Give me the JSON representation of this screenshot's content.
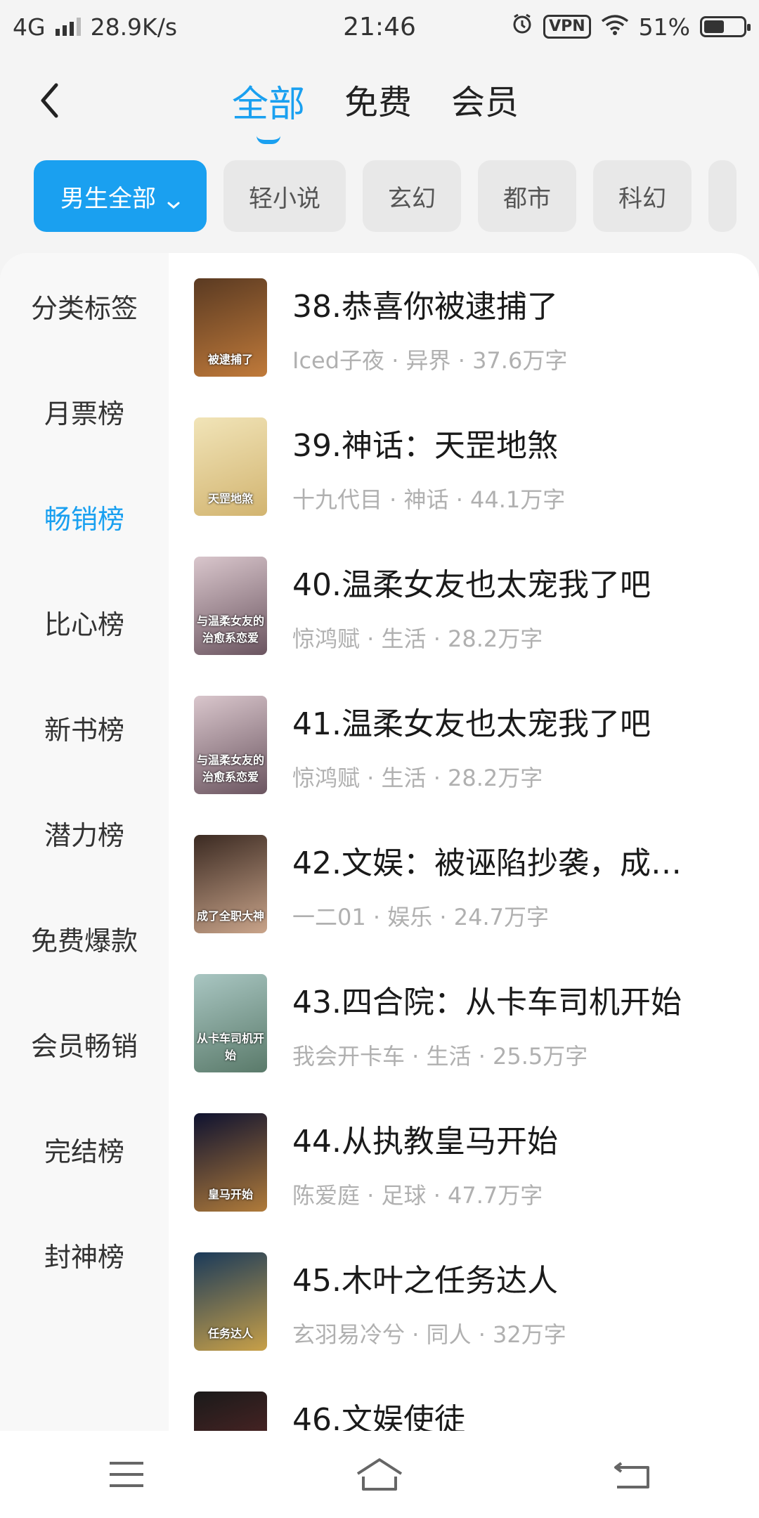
{
  "status": {
    "network": "4G",
    "speed": "28.9K/s",
    "time": "21:46",
    "vpn": "VPN",
    "battery": "51%",
    "battery_level": 0.51
  },
  "tabs": [
    {
      "label": "全部",
      "active": true
    },
    {
      "label": "免费",
      "active": false
    },
    {
      "label": "会员",
      "active": false
    }
  ],
  "filters": [
    {
      "label": "男生全部",
      "active": true
    },
    {
      "label": "轻小说",
      "active": false
    },
    {
      "label": "玄幻",
      "active": false
    },
    {
      "label": "都市",
      "active": false
    },
    {
      "label": "科幻",
      "active": false
    }
  ],
  "sidebar": {
    "items": [
      {
        "label": "分类标签",
        "active": false
      },
      {
        "label": "月票榜",
        "active": false
      },
      {
        "label": "畅销榜",
        "active": true
      },
      {
        "label": "比心榜",
        "active": false
      },
      {
        "label": "新书榜",
        "active": false
      },
      {
        "label": "潜力榜",
        "active": false
      },
      {
        "label": "免费爆款",
        "active": false
      },
      {
        "label": "会员畅销",
        "active": false
      },
      {
        "label": "完结榜",
        "active": false
      },
      {
        "label": "封神榜",
        "active": false
      }
    ]
  },
  "books": [
    {
      "title": "38.恭喜你被逮捕了",
      "meta": "Iced子夜 · 异界 · 37.6万字",
      "cover_text": "被逮捕了",
      "cover_colors": [
        "#5a3a22",
        "#c07a3a"
      ]
    },
    {
      "title": "39.神话：天罡地煞",
      "meta": "十九代目 · 神话 · 44.1万字",
      "cover_text": "天罡地煞",
      "cover_colors": [
        "#f1e4b8",
        "#d2b470"
      ]
    },
    {
      "title": "40.温柔女友也太宠我了吧",
      "meta": "惊鸿赋 · 生活 · 28.2万字",
      "cover_text": "与温柔女友的治愈系恋爱",
      "cover_colors": [
        "#d9c6cc",
        "#6b5560"
      ]
    },
    {
      "title": "41.温柔女友也太宠我了吧",
      "meta": "惊鸿赋 · 生活 · 28.2万字",
      "cover_text": "与温柔女友的治愈系恋爱",
      "cover_colors": [
        "#d9c6cc",
        "#6b5560"
      ]
    },
    {
      "title": "42.文娱：被诬陷抄袭，成…",
      "meta": "一二01 · 娱乐 · 24.7万字",
      "cover_text": "成了全职大神",
      "cover_colors": [
        "#3b2a22",
        "#c9a48a"
      ]
    },
    {
      "title": "43.四合院：从卡车司机开始",
      "meta": "我会开卡车 · 生活 · 25.5万字",
      "cover_text": "从卡车司机开始",
      "cover_colors": [
        "#a9c6c2",
        "#5a7a6a"
      ]
    },
    {
      "title": "44.从执教皇马开始",
      "meta": "陈爱庭 · 足球 · 47.7万字",
      "cover_text": "皇马开始",
      "cover_colors": [
        "#0e1230",
        "#b07b3a"
      ]
    },
    {
      "title": "45.木叶之任务达人",
      "meta": "玄羽易冷兮 · 同人 · 32万字",
      "cover_text": "任务达人",
      "cover_colors": [
        "#1a3a5a",
        "#c8a048"
      ]
    },
    {
      "title": "46.文娱使徒",
      "meta": "",
      "cover_text": "",
      "cover_colors": [
        "#1a1a1a",
        "#6a2a2a"
      ]
    }
  ]
}
